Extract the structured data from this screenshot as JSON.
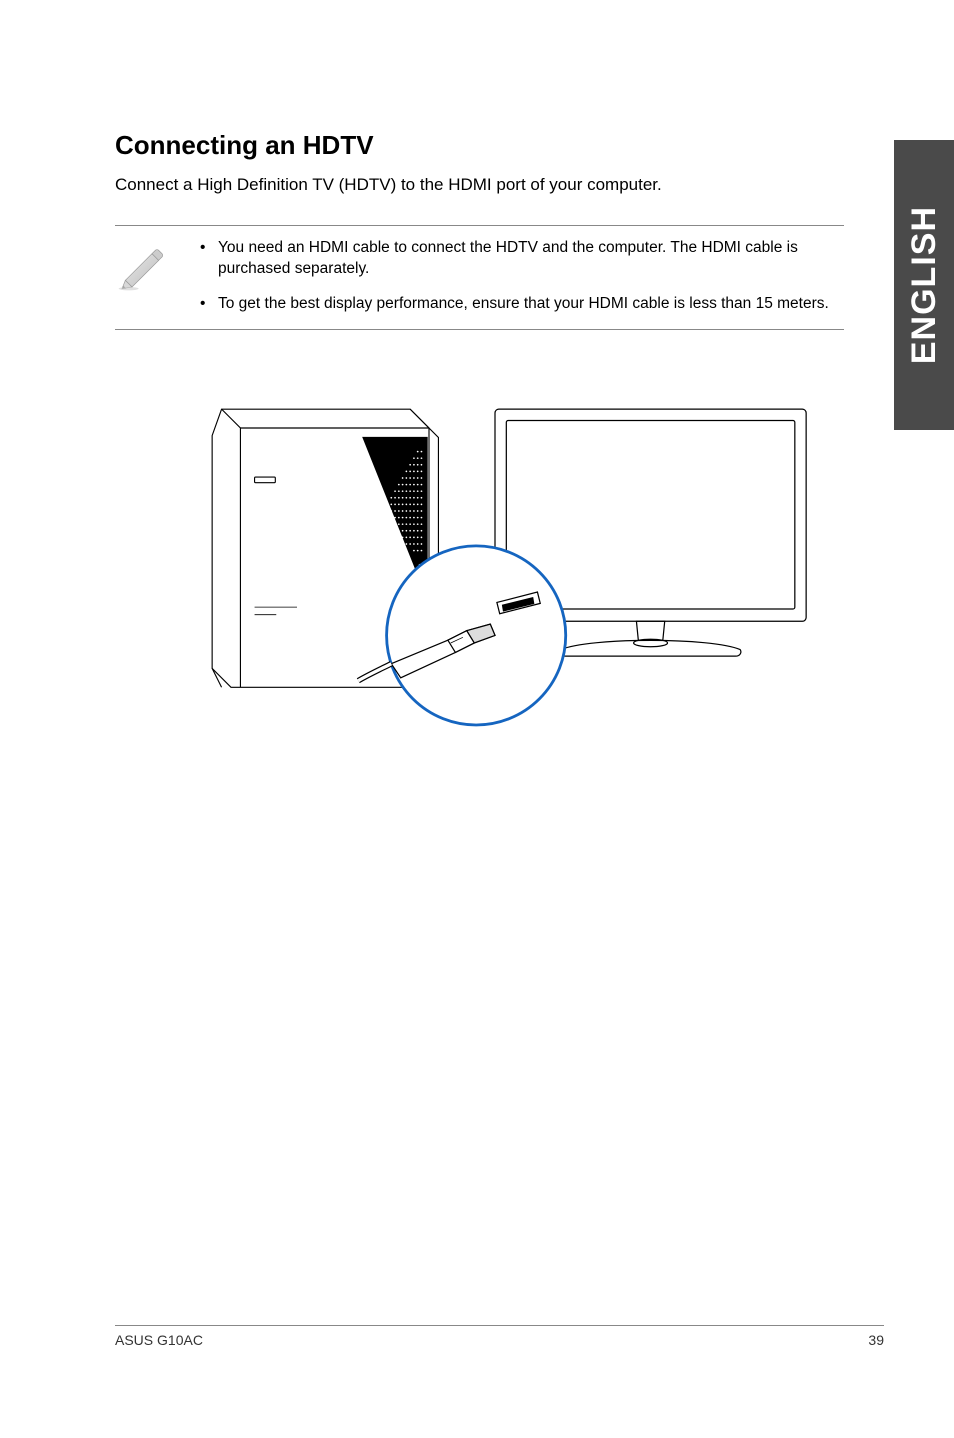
{
  "side_tab": "ENGLISH",
  "section": {
    "title": "Connecting an HDTV",
    "intro": "Connect a High Definition TV (HDTV) to the HDMI port of your computer."
  },
  "notes": {
    "items": [
      "You need an HDMI cable to connect the HDTV and the computer. The HDMI cable is purchased separately.",
      "To get the best display performance, ensure that your HDMI cable is less than 15 meters."
    ]
  },
  "footer": {
    "left": "ASUS G10AC",
    "right": "39"
  }
}
